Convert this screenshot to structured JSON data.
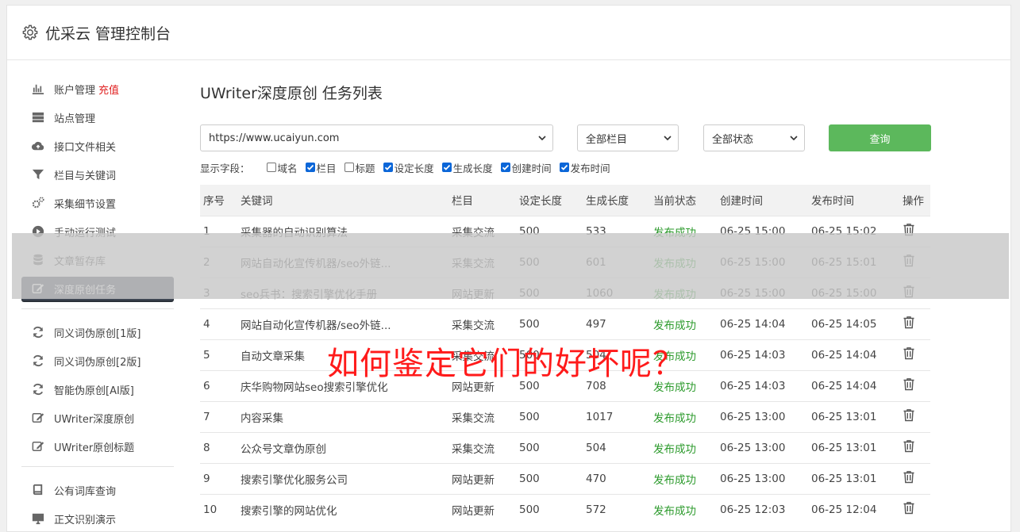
{
  "header": {
    "title": "优采云 管理控制台"
  },
  "sidebar": {
    "group1": [
      {
        "label": "账户管理",
        "badge": "充值",
        "icon": "bar-chart-icon"
      },
      {
        "label": "站点管理",
        "icon": "server-icon"
      },
      {
        "label": "接口文件相关",
        "icon": "cloud-upload-icon"
      },
      {
        "label": "栏目与关键词",
        "icon": "filter-icon"
      },
      {
        "label": "采集细节设置",
        "icon": "gears-icon"
      },
      {
        "label": "手动运行测试",
        "icon": "play-icon"
      },
      {
        "label": "文章暂存库",
        "icon": "database-icon"
      },
      {
        "label": "深度原创任务",
        "icon": "edit-icon",
        "active": true
      }
    ],
    "group2": [
      {
        "label": "同义词伪原创[1版]",
        "icon": "refresh-icon"
      },
      {
        "label": "同义词伪原创[2版]",
        "icon": "refresh-icon"
      },
      {
        "label": "智能伪原创[AI版]",
        "icon": "refresh-icon"
      },
      {
        "label": "UWriter深度原创",
        "icon": "edit-icon"
      },
      {
        "label": "UWriter原创标题",
        "icon": "edit-icon"
      }
    ],
    "group3": [
      {
        "label": "公有词库查询",
        "icon": "book-icon"
      },
      {
        "label": "正文识别演示",
        "icon": "monitor-icon"
      }
    ]
  },
  "main": {
    "title": "UWriter深度原创 任务列表",
    "site_select": "https://www.ucaiyun.com",
    "column_select": "全部栏目",
    "status_select": "全部状态",
    "query_label": "查询",
    "fields_label": "显示字段：",
    "fields": [
      {
        "label": "域名",
        "checked": false
      },
      {
        "label": "栏目",
        "checked": true
      },
      {
        "label": "标题",
        "checked": false
      },
      {
        "label": "设定长度",
        "checked": true
      },
      {
        "label": "生成长度",
        "checked": true
      },
      {
        "label": "创建时间",
        "checked": true
      },
      {
        "label": "发布时间",
        "checked": true
      }
    ],
    "table": {
      "headers": [
        "序号",
        "关键词",
        "栏目",
        "设定长度",
        "生成长度",
        "当前状态",
        "创建时间",
        "发布时间",
        "操作"
      ],
      "rows": [
        [
          "1",
          "采集器的自动识别算法",
          "采集交流",
          "500",
          "533",
          "发布成功",
          "06-25 15:00",
          "06-25 15:02"
        ],
        [
          "2",
          "网站自动化宣传机器/seo外链...",
          "采集交流",
          "500",
          "601",
          "发布成功",
          "06-25 15:00",
          "06-25 15:01"
        ],
        [
          "3",
          "seo兵书：搜索引擎优化手册",
          "网站更新",
          "500",
          "1060",
          "发布成功",
          "06-25 15:00",
          "06-25 15:00"
        ],
        [
          "4",
          "网站自动化宣传机器/seo外链...",
          "采集交流",
          "500",
          "497",
          "发布成功",
          "06-25 14:04",
          "06-25 14:05"
        ],
        [
          "5",
          "自动文章采集",
          "采集交流",
          "500",
          "504",
          "发布成功",
          "06-25 14:03",
          "06-25 14:04"
        ],
        [
          "6",
          "庆华购物网站seo搜索引擎优化",
          "网站更新",
          "500",
          "708",
          "发布成功",
          "06-25 14:03",
          "06-25 14:04"
        ],
        [
          "7",
          "内容采集",
          "采集交流",
          "500",
          "1017",
          "发布成功",
          "06-25 13:00",
          "06-25 13:01"
        ],
        [
          "8",
          "公众号文章伪原创",
          "采集交流",
          "500",
          "504",
          "发布成功",
          "06-25 13:00",
          "06-25 13:01"
        ],
        [
          "9",
          "搜索引擎优化服务公司",
          "网站更新",
          "500",
          "470",
          "发布成功",
          "06-25 13:00",
          "06-25 13:01"
        ],
        [
          "10",
          "搜索引擎的网站优化",
          "网站更新",
          "500",
          "572",
          "发布成功",
          "06-25 12:03",
          "06-25 12:04"
        ]
      ]
    }
  },
  "overlay": {
    "caption": "如何鉴定它们的好坏呢？"
  },
  "colors": {
    "accent_green": "#5cb85c",
    "status_green": "#2b9a2b",
    "active_nav": "#3d4552",
    "recharge_red": "#e02020",
    "caption_red": "#ff1a1a"
  }
}
